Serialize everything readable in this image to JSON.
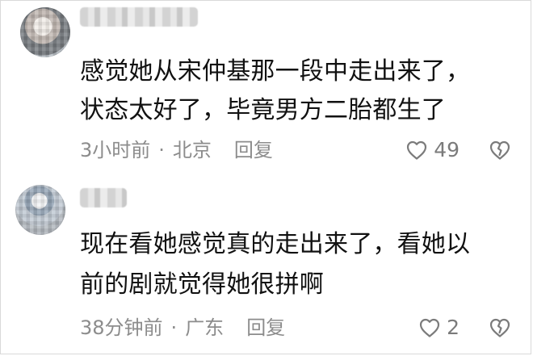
{
  "comments": [
    {
      "text_lines": [
        "感觉她从宋仲基那一段中走出来了，",
        "状态太好了，毕竟男方二胎都生了"
      ],
      "time": "3小时前",
      "location": "北京",
      "reply_label": "回复",
      "likes": "49",
      "like_icon": "heart-outline-icon",
      "dislike_icon": "broken-heart-icon"
    },
    {
      "text_lines": [
        "现在看她感觉真的走出来了，看她以",
        "前的剧就觉得她很拼啊"
      ],
      "time": "38分钟前",
      "location": "广东",
      "reply_label": "回复",
      "likes": "2",
      "like_icon": "heart-outline-icon",
      "dislike_icon": "broken-heart-icon"
    }
  ],
  "colors": {
    "text": "#111111",
    "meta": "#8c8c8c",
    "icon": "#7b7b7b",
    "background": "#ffffff"
  }
}
